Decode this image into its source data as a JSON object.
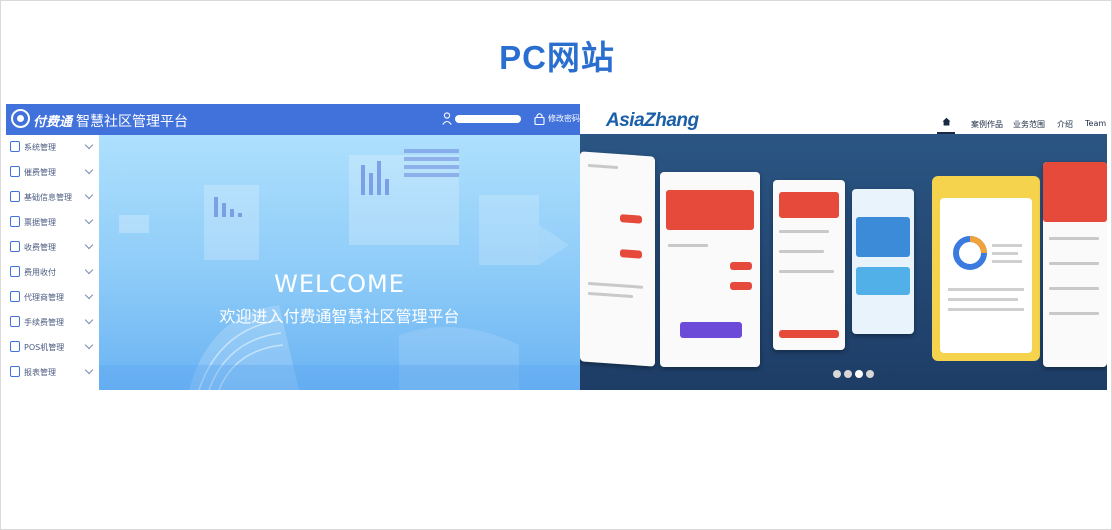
{
  "slide": {
    "title": "PC网站"
  },
  "left_site": {
    "logo_text": "付费通",
    "platform_name": "智慧社区管理平台",
    "change_password": "修改密码",
    "sidebar": [
      {
        "label": "系统管理",
        "icon": "monitor-icon"
      },
      {
        "label": "催费管理",
        "icon": "bell-icon"
      },
      {
        "label": "基础信息管理",
        "icon": "grid-icon"
      },
      {
        "label": "票据管理",
        "icon": "ticket-icon"
      },
      {
        "label": "收费管理",
        "icon": "calendar-icon"
      },
      {
        "label": "费用收付",
        "icon": "wallet-icon"
      },
      {
        "label": "代理商管理",
        "icon": "people-icon"
      },
      {
        "label": "手续费管理",
        "icon": "yen-icon"
      },
      {
        "label": "POS机管理",
        "icon": "pos-icon"
      },
      {
        "label": "报表管理",
        "icon": "report-icon"
      }
    ],
    "welcome_en": "WELCOME",
    "welcome_cn": "欢迎进入付费通智慧社区管理平台",
    "colors": {
      "header": "#4172dc",
      "accent": "#2a6fd0"
    }
  },
  "right_site": {
    "logo": "AsiaZhang",
    "nav": [
      "案例作品",
      "业务范围",
      "介绍",
      "Team"
    ],
    "carousel_dot_count": 4
  }
}
